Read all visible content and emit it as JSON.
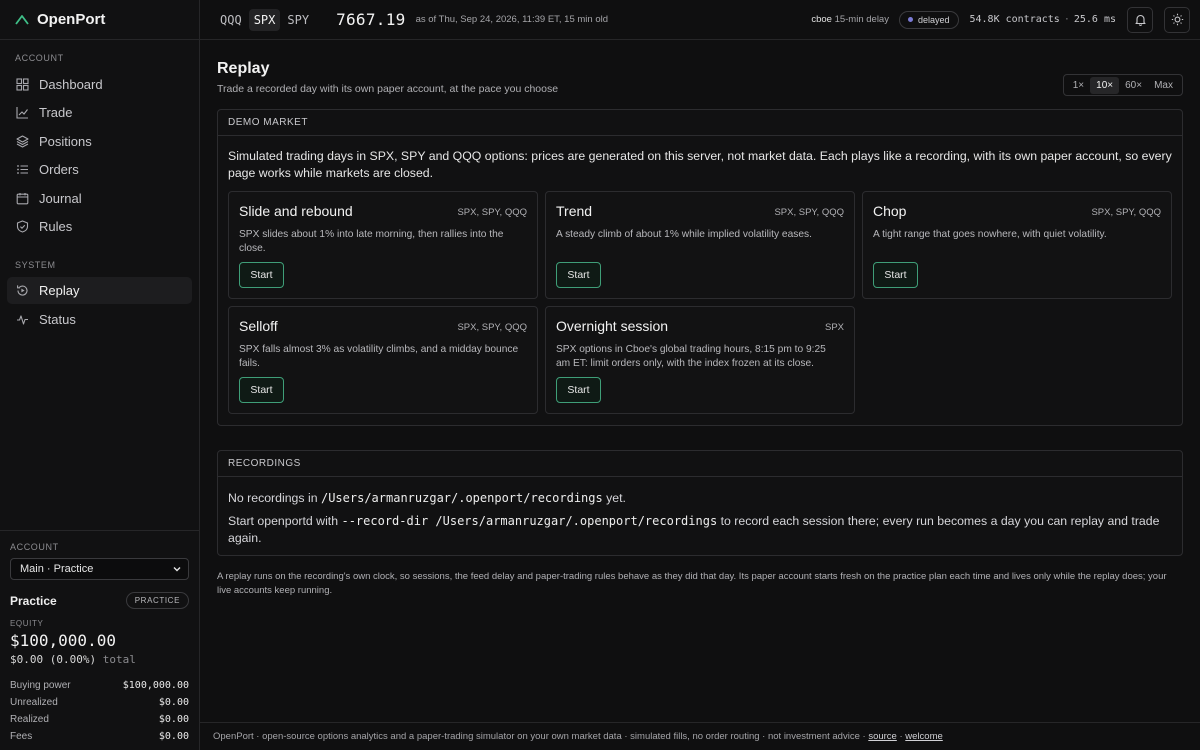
{
  "app": {
    "name": "OpenPort"
  },
  "sidebar": {
    "account_heading": "ACCOUNT",
    "account_items": [
      {
        "label": "Dashboard",
        "icon": "dashboard-icon"
      },
      {
        "label": "Trade",
        "icon": "chart-line-icon"
      },
      {
        "label": "Positions",
        "icon": "layers-icon"
      },
      {
        "label": "Orders",
        "icon": "list-icon"
      },
      {
        "label": "Journal",
        "icon": "calendar-icon"
      },
      {
        "label": "Rules",
        "icon": "shield-icon"
      }
    ],
    "system_heading": "SYSTEM",
    "system_items": [
      {
        "label": "Replay",
        "icon": "replay-icon",
        "active": true
      },
      {
        "label": "Status",
        "icon": "activity-icon"
      }
    ]
  },
  "account_panel": {
    "label": "ACCOUNT",
    "selected": "Main · Practice",
    "plan": "Practice",
    "plan_badge": "PRACTICE",
    "equity_label": "EQUITY",
    "equity": "$100,000.00",
    "change": "$0.00 (0.00%)",
    "change_suffix": "total",
    "rows": [
      {
        "label": "Buying power",
        "value": "$100,000.00"
      },
      {
        "label": "Unrealized",
        "value": "$0.00"
      },
      {
        "label": "Realized",
        "value": "$0.00"
      },
      {
        "label": "Fees",
        "value": "$0.00"
      }
    ]
  },
  "topbar": {
    "symbols": [
      "QQQ",
      "SPX",
      "SPY"
    ],
    "active_symbol": "SPX",
    "price": "7667.19",
    "as_of": "as of Thu, Sep 24, 2026, 11:39 ET, 15 min old",
    "feed_source": "cboe",
    "feed_delay": "15-min delay",
    "status_pill": "delayed",
    "contracts": "54.8K contracts",
    "separator": "·",
    "latency": "25.6 ms"
  },
  "page": {
    "title": "Replay",
    "subtitle": "Trade a recorded day with its own paper account, at the pace you choose",
    "speeds": [
      "1×",
      "10×",
      "60×",
      "Max"
    ],
    "active_speed": "10×"
  },
  "demo": {
    "heading": "DEMO MARKET",
    "intro": "Simulated trading days in SPX, SPY and QQQ options: prices are generated on this server, not market data. Each plays like a recording, with its own paper account, so every page works while markets are closed.",
    "start_label": "Start",
    "cards": [
      {
        "title": "Slide and rebound",
        "symbols": "SPX, SPY, QQQ",
        "desc": "SPX slides about 1% into late morning, then rallies into the close."
      },
      {
        "title": "Trend",
        "symbols": "SPX, SPY, QQQ",
        "desc": "A steady climb of about 1% while implied volatility eases."
      },
      {
        "title": "Chop",
        "symbols": "SPX, SPY, QQQ",
        "desc": "A tight range that goes nowhere, with quiet volatility."
      },
      {
        "title": "Selloff",
        "symbols": "SPX, SPY, QQQ",
        "desc": "SPX falls almost 3% as volatility climbs, and a midday bounce fails."
      },
      {
        "title": "Overnight session",
        "symbols": "SPX",
        "desc": "SPX options in Cboe's global trading hours, 8:15 pm to 9:25 am ET: limit orders only, with the index frozen at its close."
      }
    ]
  },
  "recordings": {
    "heading": "RECORDINGS",
    "empty_prefix": "No recordings in",
    "path": "/Users/armanruzgar/.openport/recordings",
    "empty_suffix": "yet.",
    "hint_prefix": "Start openportd with",
    "hint_cmd": "--record-dir /Users/armanruzgar/.openport/recordings",
    "hint_suffix": "to record each session there; every run becomes a day you can replay and trade again."
  },
  "footnote": "A replay runs on the recording's own clock, so sessions, the feed delay and paper-trading rules behave as they did that day. Its paper account starts fresh on the practice plan each time and lives only while the replay does; your live accounts keep running.",
  "footer": {
    "text": "OpenPort · open-source options analytics and a paper-trading simulator on your own market data · simulated fills, no order routing · not investment advice ·",
    "link_source": "source",
    "sep": "·",
    "link_welcome": "welcome"
  },
  "colors": {
    "accent": "#3f9e78",
    "background": "#0f0f10",
    "pill_dot": "#7b7bd6"
  }
}
